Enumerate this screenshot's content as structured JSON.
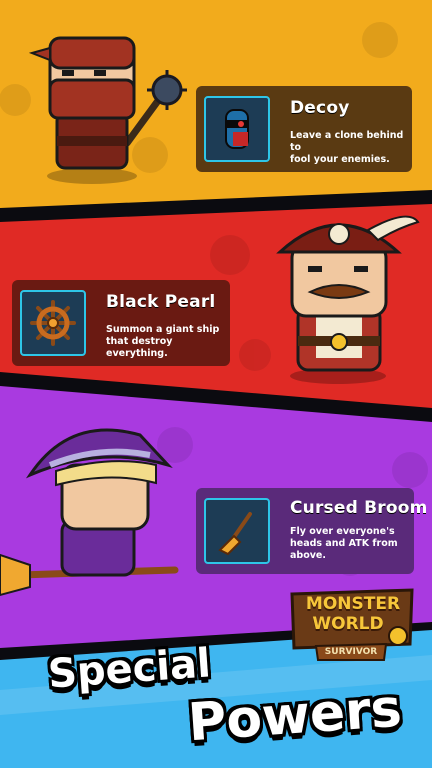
{
  "colors": {
    "panel1": "#f2ab1c",
    "panel2": "#e02a25",
    "panel3": "#a93ae0",
    "bottom": "#3fb6f0",
    "card_bg": "#5a3a12",
    "icon_bg": "#1d3c55",
    "icon_border": "#2ec6e8"
  },
  "powers": [
    {
      "title": "Decoy",
      "desc_line1": "Leave a clone behind to",
      "desc_line2": "fool your enemies.",
      "icon": "ninja-clone-icon"
    },
    {
      "title": "Black Pearl",
      "desc_line1": "Summon a giant ship",
      "desc_line2": "that destroy everything.",
      "icon": "ship-wheel-icon"
    },
    {
      "title": "Cursed Broom",
      "desc_line1": "Fly over everyone's",
      "desc_line2": "heads and ATK from",
      "desc_line3": "above.",
      "icon": "broom-icon"
    }
  ],
  "characters": [
    "ninja-character",
    "pirate-character",
    "witch-character"
  ],
  "logo": {
    "line1": "MONSTER",
    "line2": "WORLD",
    "sub": "SURVIVOR"
  },
  "headline": {
    "word1": "Special",
    "word2": "Powers"
  }
}
